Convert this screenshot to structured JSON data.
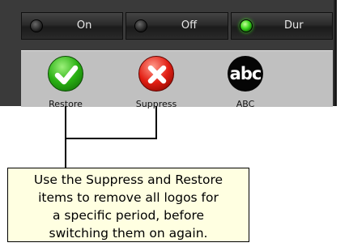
{
  "toggles": [
    {
      "label": "On",
      "led": "off"
    },
    {
      "label": "Off",
      "led": "off"
    },
    {
      "label": "Dur",
      "led": "on"
    }
  ],
  "items": [
    {
      "label": "Restore",
      "icon": "checkmark-icon"
    },
    {
      "label": "Suppress",
      "icon": "x-icon"
    },
    {
      "label": "ABC",
      "icon": "abc-logo",
      "logo_text": "abc"
    }
  ],
  "callout": {
    "lines": [
      "Use the Suppress and Restore",
      "items to remove all logos for",
      "a specific period, before",
      "switching them on again."
    ]
  },
  "colors": {
    "frame": "#3a3a3a",
    "panel": "#c0c0c0",
    "led_on": "#3bd61e",
    "callout_bg": "#ffffe1"
  }
}
